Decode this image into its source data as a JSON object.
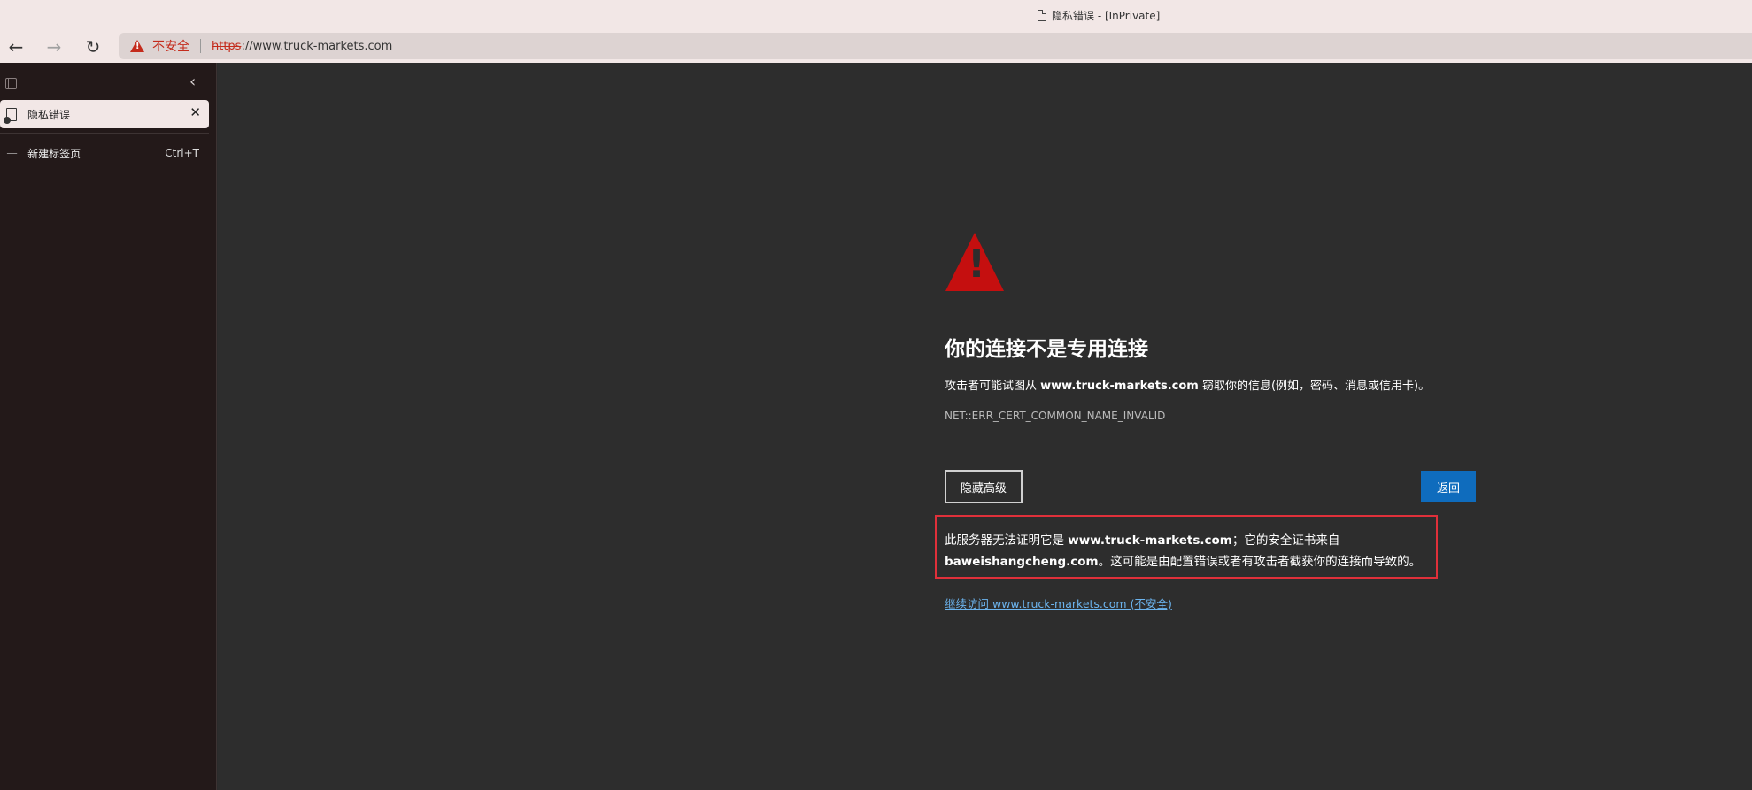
{
  "window": {
    "title": "隐私错误 - [InPrivate]"
  },
  "navbar": {
    "back_icon": "←",
    "forward_icon": "→",
    "refresh_icon": "↻",
    "security_label": "不安全",
    "url_scheme": "https",
    "url_rest": "://www.truck-markets.com"
  },
  "sidebar": {
    "collapse_icon": "‹",
    "tabs": [
      {
        "label": "隐私错误",
        "close_icon": "✕"
      }
    ],
    "new_tab_label": "新建标签页",
    "new_tab_shortcut": "Ctrl+T",
    "plus_icon": "+"
  },
  "error_page": {
    "heading": "你的连接不是专用连接",
    "desc_prefix": "攻击者可能试图从 ",
    "desc_domain": "www.truck-markets.com",
    "desc_suffix": " 窃取你的信息(例如，密码、消息或信用卡)。",
    "error_code": "NET::ERR_CERT_COMMON_NAME_INVALID",
    "hide_advanced_label": "隐藏高级",
    "back_label": "返回",
    "advanced": {
      "prefix": "此服务器无法证明它是 ",
      "domain": "www.truck-markets.com",
      "middle": "；它的安全证书来自 ",
      "cert_domain": "baweishangcheng.com",
      "suffix": "。这可能是由配置错误或者有攻击者截获你的连接而导致的。"
    },
    "continue_link": "继续访问 www.truck-markets.com (不安全)"
  },
  "colors": {
    "warning_red": "#c50f0f",
    "primary_blue": "#0f6cbd",
    "link_blue": "#6cb4ee",
    "highlight_box": "#e0303a"
  }
}
